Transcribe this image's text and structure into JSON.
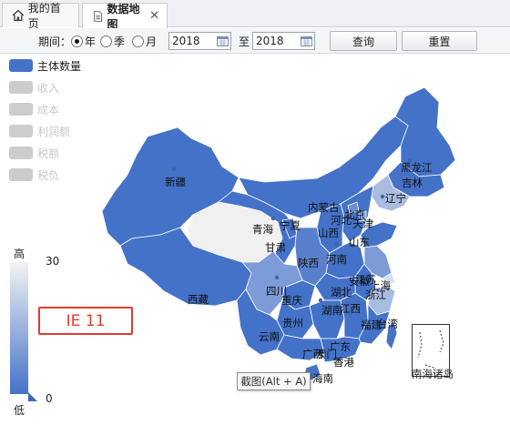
{
  "tabs": [
    {
      "label": "我的首页",
      "icon": "home-icon"
    },
    {
      "label": "数据地图",
      "icon": "document-icon",
      "close": "✕"
    }
  ],
  "filter": {
    "period_label": "期间：",
    "options": [
      {
        "label": "年",
        "selected": true
      },
      {
        "label": "季",
        "selected": false
      },
      {
        "label": "月",
        "selected": false
      }
    ],
    "from_value": "2018",
    "to_label": "至",
    "to_value": "2018",
    "query_label": "查询",
    "reset_label": "重置"
  },
  "legend": [
    {
      "label": "主体数量",
      "active": true
    },
    {
      "label": "收入",
      "active": false
    },
    {
      "label": "成本",
      "active": false
    },
    {
      "label": "利润额",
      "active": false
    },
    {
      "label": "税额",
      "active": false
    },
    {
      "label": "税负",
      "active": false
    }
  ],
  "visual_map": {
    "high_label": "高",
    "low_label": "低",
    "max": "30",
    "min": "0",
    "color_high": "#4472c8",
    "color_low": "#f3f3f3"
  },
  "ie_label": "IE 11",
  "tooltip": "截图(Alt + A)",
  "inset_label": "南海诸岛",
  "provinces": {
    "xinjiang": "新疆",
    "xizang": "西藏",
    "qinghai": "青海",
    "gansu": "甘肃",
    "ningxia": "宁夏",
    "neimenggu": "内蒙古",
    "heilongjiang": "黑龙江",
    "jilin": "吉林",
    "liaoning": "辽宁",
    "beijing": "北京",
    "tianjin": "天津",
    "hebei": "河北",
    "shanxi": "山西",
    "shandong": "山东",
    "shaanxi": "陕西",
    "henan": "河南",
    "jiangsu": "江苏",
    "anhui": "安徽",
    "shanghai": "上海",
    "hubei": "湖北",
    "zhejiang": "浙江",
    "sichuan": "四川",
    "chongqing": "重庆",
    "hunan": "湖南",
    "jiangxi": "江西",
    "guizhou": "贵州",
    "yunnan": "云南",
    "guangxi": "广西",
    "guangdong": "广东",
    "fujian": "福建",
    "taiwan": "台湾",
    "hongkong": "香港",
    "macau": "澳门",
    "hainan": "海南"
  }
}
